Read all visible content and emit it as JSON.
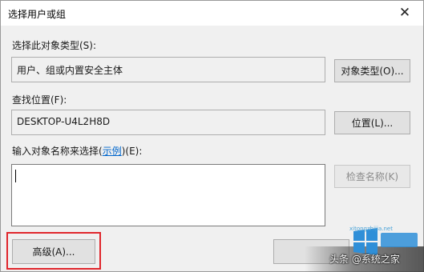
{
  "window": {
    "title": "选择用户或组",
    "close_symbol": "✕"
  },
  "object_type": {
    "label": "选择此对象类型(S):",
    "value": "用户、组或内置安全主体",
    "button": "对象类型(O)..."
  },
  "location": {
    "label": "查找位置(F):",
    "value": "DESKTOP-U4L2H8D",
    "button": "位置(L)..."
  },
  "names": {
    "label_prefix": "输入对象名称来选择(",
    "label_link": "示例",
    "label_suffix": ")(E):",
    "value": "",
    "check_button": "检查名称(K)"
  },
  "footer": {
    "advanced_button": "高级(A)..."
  },
  "watermark": {
    "brand_url": "xitongzhijia.net",
    "caption": "头条 @系统之家",
    "logo_text": "系统之家"
  },
  "colors": {
    "highlight_border": "#e0262c",
    "link": "#0066cc"
  }
}
